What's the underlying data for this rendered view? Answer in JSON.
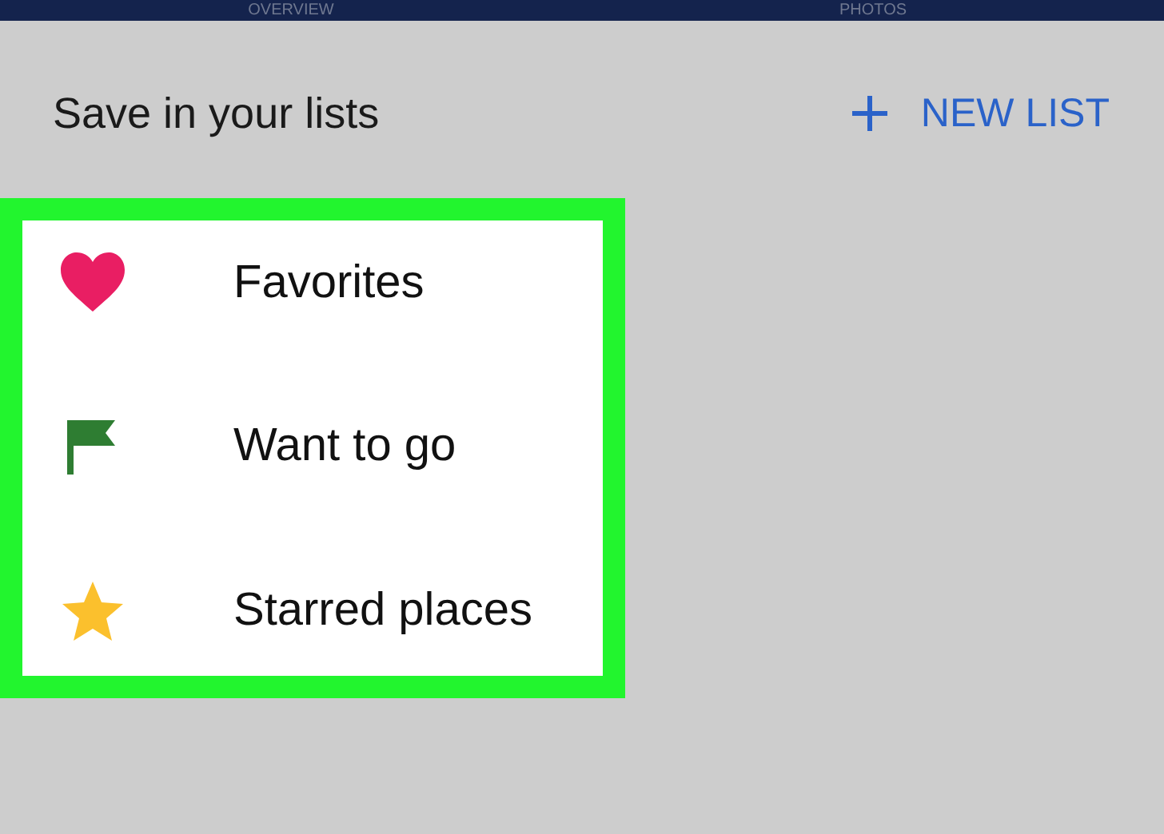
{
  "tabs": [
    {
      "label": "OVERVIEW"
    },
    {
      "label": "PHOTOS"
    }
  ],
  "header": {
    "title": "Save in your lists",
    "new_list_button": "NEW LIST"
  },
  "lists": [
    {
      "kind": "heart",
      "label": "Favorites"
    },
    {
      "kind": "flag",
      "label": "Want to go"
    },
    {
      "kind": "star",
      "label": "Starred places"
    }
  ]
}
